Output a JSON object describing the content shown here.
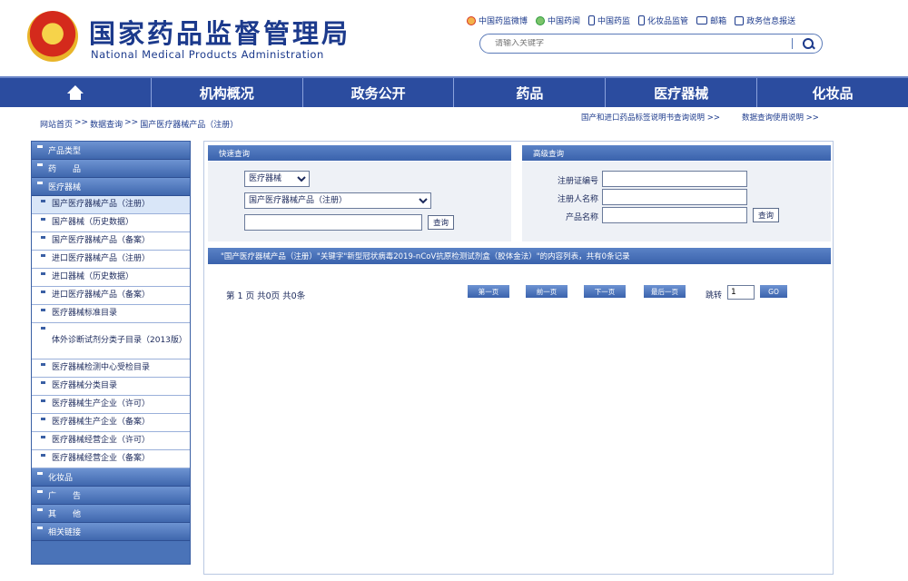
{
  "header": {
    "title": "国家药品监督管理局",
    "subtitle": "National Medical Products Administration",
    "top_links": [
      {
        "icon": "weibo-icon",
        "label": "中国药监微博"
      },
      {
        "icon": "wechat-icon",
        "label": "中国药闻"
      },
      {
        "icon": "phone-icon",
        "label": "中国药监"
      },
      {
        "icon": "phone-icon",
        "label": "化妆品监管"
      },
      {
        "icon": "mail-icon",
        "label": "邮箱"
      },
      {
        "icon": "report-icon",
        "label": "政务信息报送"
      }
    ],
    "search": {
      "placeholder": "请输入关键字"
    }
  },
  "nav": {
    "items": [
      "机构概况",
      "政务公开",
      "药品",
      "医疗器械",
      "化妆品"
    ]
  },
  "breadcrumb": [
    "网站首页",
    "数据查询",
    "国产医疗器械产品（注册）"
  ],
  "right_links": [
    "国产和进口药品标签说明书查询说明 >>",
    "数据查询使用说明 >>"
  ],
  "sidebar": {
    "top_categories": [
      "产品类型",
      "药　　品",
      "医疗器械"
    ],
    "sub_items": [
      "国产医疗器械产品（注册）",
      "国产器械（历史数据）",
      "国产医疗器械产品（备案）",
      "进口医疗器械产品（注册）",
      "进口器械（历史数据）",
      "进口医疗器械产品（备案）",
      "医疗器械标准目录",
      "体外诊断试剂分类子目录（2013版）",
      "医疗器械检测中心受检目录",
      "医疗器械分类目录",
      "医疗器械生产企业（许可）",
      "医疗器械生产企业（备案）",
      "医疗器械经营企业（许可）",
      "医疗器械经营企业（备案）"
    ],
    "bottom_categories": [
      "化妆品",
      "广　　告",
      "其　　他",
      "相关链接"
    ]
  },
  "quick_search": {
    "header": "快速查询",
    "category_selected": "医疗器械",
    "type_selected": "国产医疗器械产品（注册）",
    "keyword_value": "",
    "button": "查询"
  },
  "advanced_search": {
    "header": "高级查询",
    "fields": [
      {
        "label": "注册证编号",
        "value": ""
      },
      {
        "label": "注册人名称",
        "value": ""
      },
      {
        "label": "产品名称",
        "value": ""
      }
    ],
    "button": "查询"
  },
  "result_bar": "\"国产医疗器械产品（注册）\"关键字\"新型冠状病毒2019-nCoV抗原检测试剂盒（胶体金法）\"的内容列表，共有0条记录",
  "pager": {
    "status": "第 1 页 共0页 共0条",
    "buttons": [
      "第一页",
      "前一页",
      "下一页",
      "最后一页"
    ],
    "jump_label": "跳转",
    "jump_value": "1",
    "go_button": "GO"
  },
  "colors": {
    "nav_blue": "#2b4c9f",
    "sidebar_blue": "#4a73b8",
    "title_blue": "#1c3a8c"
  }
}
